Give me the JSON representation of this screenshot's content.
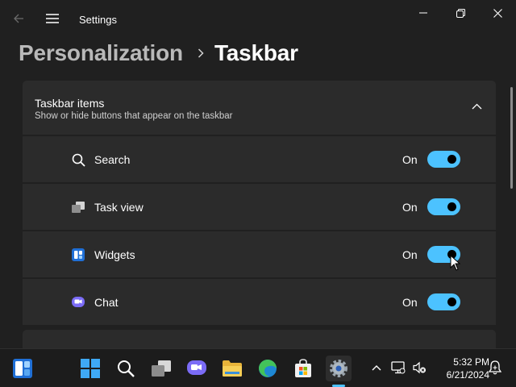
{
  "window": {
    "title": "Settings",
    "controls": [
      "minimize",
      "maximize",
      "close"
    ]
  },
  "breadcrumb": {
    "parent": "Personalization",
    "current": "Taskbar"
  },
  "section": {
    "title": "Taskbar items",
    "description": "Show or hide buttons that appear on the taskbar",
    "expanded": true
  },
  "items": [
    {
      "label": "Search",
      "state": "On",
      "enabled": true,
      "icon": "search-icon"
    },
    {
      "label": "Task view",
      "state": "On",
      "enabled": true,
      "icon": "task-view-icon"
    },
    {
      "label": "Widgets",
      "state": "On",
      "enabled": true,
      "icon": "widgets-icon"
    },
    {
      "label": "Chat",
      "state": "On",
      "enabled": true,
      "icon": "chat-icon"
    }
  ],
  "taskbar": {
    "apps": [
      "widgets",
      "start",
      "search",
      "task-view",
      "chat",
      "file-explorer",
      "edge",
      "store",
      "settings"
    ],
    "active_app": "settings",
    "clock": {
      "time": "5:32 PM",
      "date": "6/21/2024"
    }
  },
  "colors": {
    "background": "#202020",
    "card": "#2b2b2b",
    "accent": "#4cc2ff",
    "taskbar": "#1c1c1c"
  }
}
